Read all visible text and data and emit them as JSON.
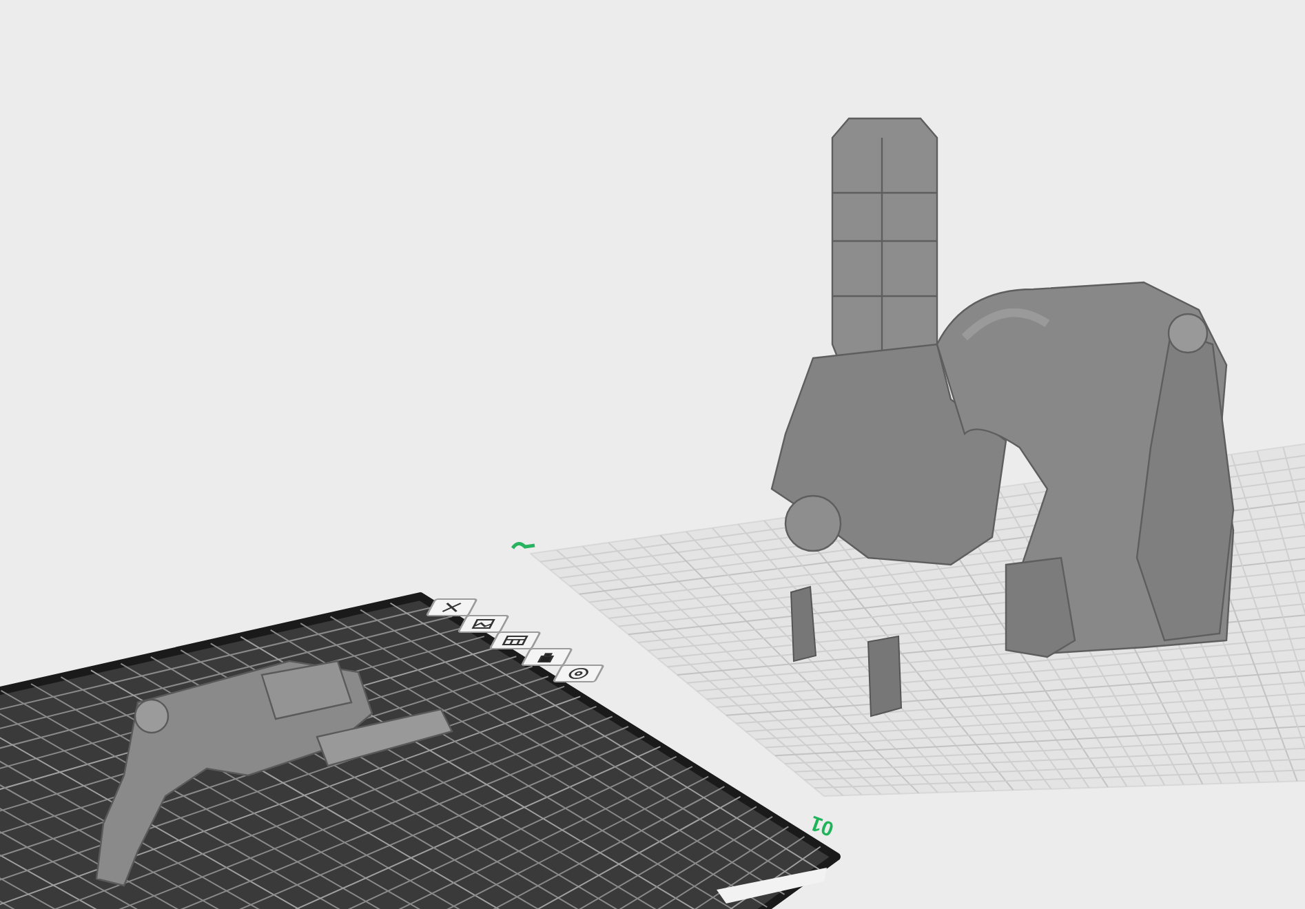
{
  "viewport": {
    "plates": [
      {
        "kind": "light",
        "selected": false
      },
      {
        "kind": "dark",
        "selected": true,
        "label": "01"
      }
    ]
  }
}
